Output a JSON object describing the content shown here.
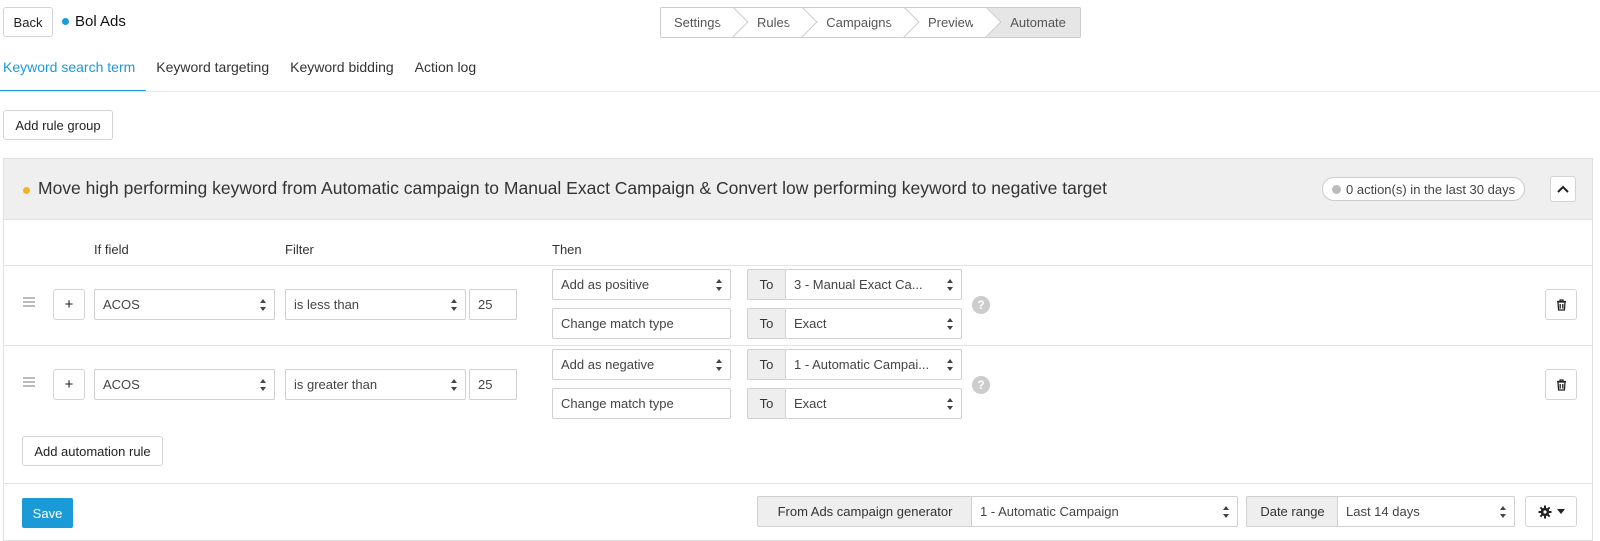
{
  "header": {
    "back_label": "Back",
    "app_title": "Bol Ads",
    "steps": [
      "Settings",
      "Rules",
      "Campaigns",
      "Preview",
      "Automate"
    ],
    "active_step": "Automate"
  },
  "tabs": [
    {
      "label": "Keyword search term",
      "active": true
    },
    {
      "label": "Keyword targeting",
      "active": false
    },
    {
      "label": "Keyword bidding",
      "active": false
    },
    {
      "label": "Action log",
      "active": false
    }
  ],
  "toolbar": {
    "add_rule_group_label": "Add rule group"
  },
  "rule_group": {
    "title": "Move high performing keyword from Automatic campaign to Manual Exact Campaign & Convert low performing keyword to negative target",
    "actions_badge": "0 action(s) in the last 30 days",
    "columns": {
      "if_field": "If field",
      "filter": "Filter",
      "then": "Then"
    },
    "rules": [
      {
        "field": "ACOS",
        "filter": "is less than",
        "value": "25",
        "actions": [
          {
            "action": "Add as positive",
            "to_label": "To",
            "target": "3 - Manual Exact Ca..."
          },
          {
            "action": "Change match type",
            "to_label": "To",
            "target": "Exact"
          }
        ]
      },
      {
        "field": "ACOS",
        "filter": "is greater than",
        "value": "25",
        "actions": [
          {
            "action": "Add as negative",
            "to_label": "To",
            "target": "1 - Automatic Campai..."
          },
          {
            "action": "Change match type",
            "to_label": "To",
            "target": "Exact"
          }
        ]
      }
    ],
    "add_automation_rule_label": "Add automation rule",
    "footer": {
      "save_label": "Save",
      "source_label": "From Ads campaign generator",
      "source_value": "1 - Automatic Campaign",
      "date_range_label": "Date range",
      "date_range_value": "Last 14 days"
    }
  },
  "colors": {
    "accent": "#1a9ad6",
    "status_dot": "#f0b429"
  }
}
